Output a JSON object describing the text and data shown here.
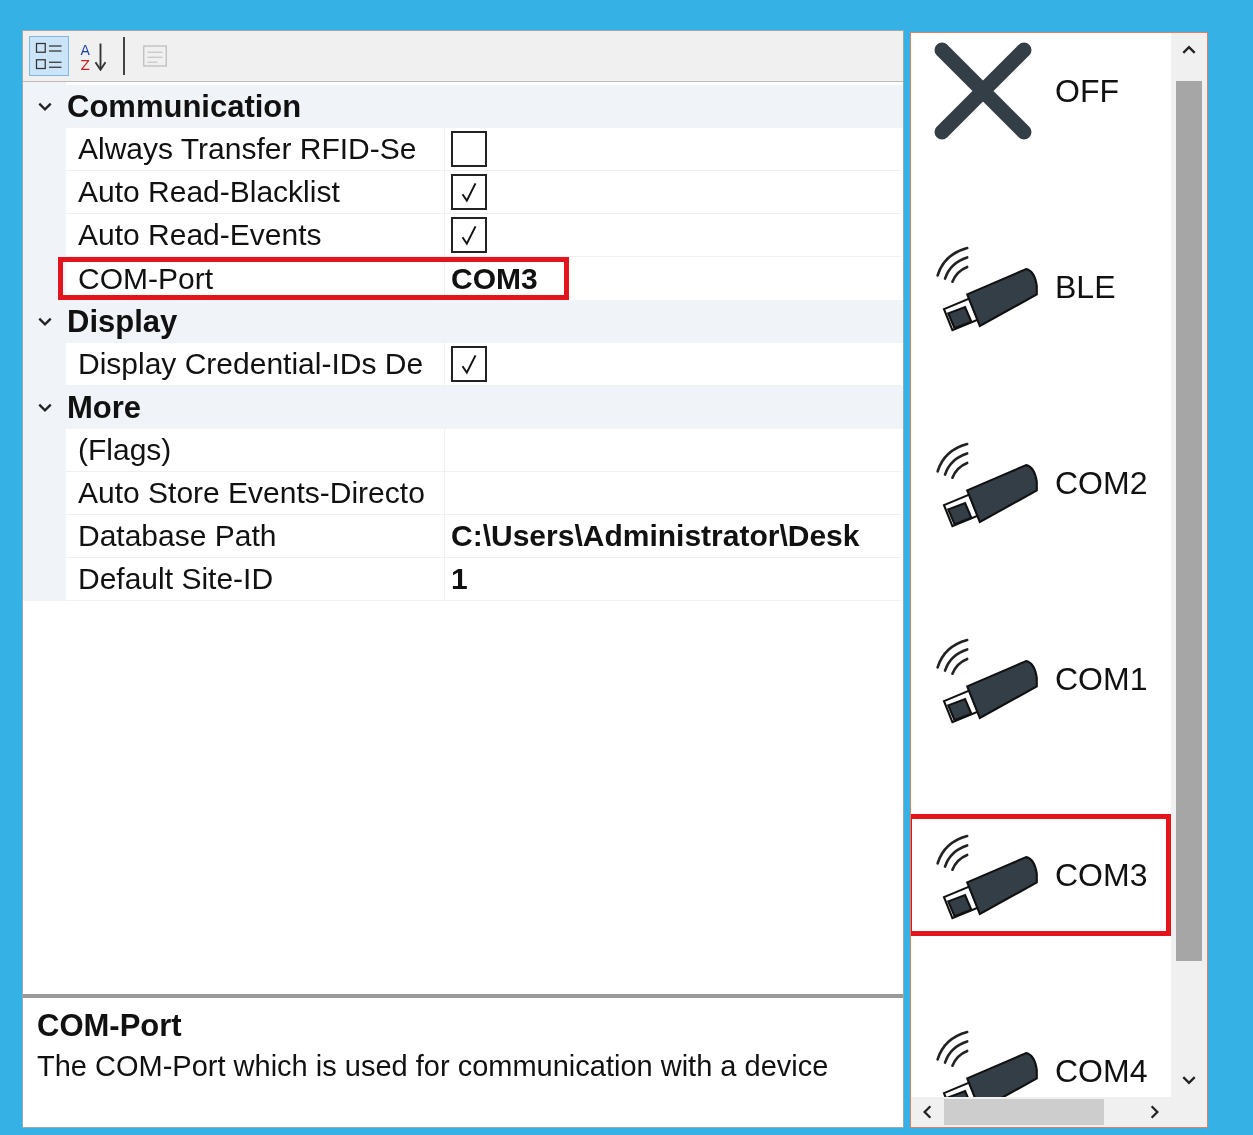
{
  "toolbar": [
    {
      "kind": "categorized",
      "selected": true,
      "disabled": false
    },
    {
      "kind": "alphabetical",
      "selected": false,
      "disabled": false,
      "letters": [
        "A",
        "Z"
      ]
    },
    {
      "kind": "pages",
      "selected": false,
      "disabled": true
    }
  ],
  "categories": [
    {
      "name": "Communication",
      "expanded": true,
      "properties": [
        {
          "name": "Always Transfer RFID-Se",
          "kind": "checkbox",
          "checked": false,
          "highlighted": false
        },
        {
          "name": "Auto Read-Blacklist",
          "kind": "checkbox",
          "checked": true,
          "highlighted": false
        },
        {
          "name": "Auto Read-Events",
          "kind": "checkbox",
          "checked": true,
          "highlighted": false
        },
        {
          "name": "COM-Port",
          "kind": "text",
          "value": "COM3",
          "bold": true,
          "highlighted": true
        }
      ]
    },
    {
      "name": "Display",
      "expanded": true,
      "properties": [
        {
          "name": "Display Credential-IDs De",
          "kind": "checkbox",
          "checked": true,
          "highlighted": false
        }
      ]
    },
    {
      "name": "More",
      "expanded": true,
      "properties": [
        {
          "name": "(Flags)",
          "kind": "text",
          "highlighted": false
        },
        {
          "name": "Auto Store Events-Directo",
          "kind": "text",
          "highlighted": false
        },
        {
          "name": "Database Path",
          "kind": "text",
          "value": "C:\\Users\\Administrator\\Desk",
          "bold": true,
          "highlighted": false
        },
        {
          "name": "Default Site-ID",
          "kind": "text",
          "value": "1",
          "bold": true,
          "highlighted": false
        }
      ]
    }
  ],
  "description": {
    "title": "COM-Port",
    "text": "The COM-Port which is used for communication with a device"
  },
  "devices": [
    {
      "label": "OFF",
      "kind": "off",
      "highlighted": false
    },
    {
      "label": "BLE",
      "kind": "dongle",
      "highlighted": false
    },
    {
      "label": "COM2",
      "kind": "dongle",
      "highlighted": false
    },
    {
      "label": "COM1",
      "kind": "dongle",
      "highlighted": false
    },
    {
      "label": "COM3",
      "kind": "dongle",
      "highlighted": true
    },
    {
      "label": "COM4",
      "kind": "dongle",
      "highlighted": false
    }
  ]
}
